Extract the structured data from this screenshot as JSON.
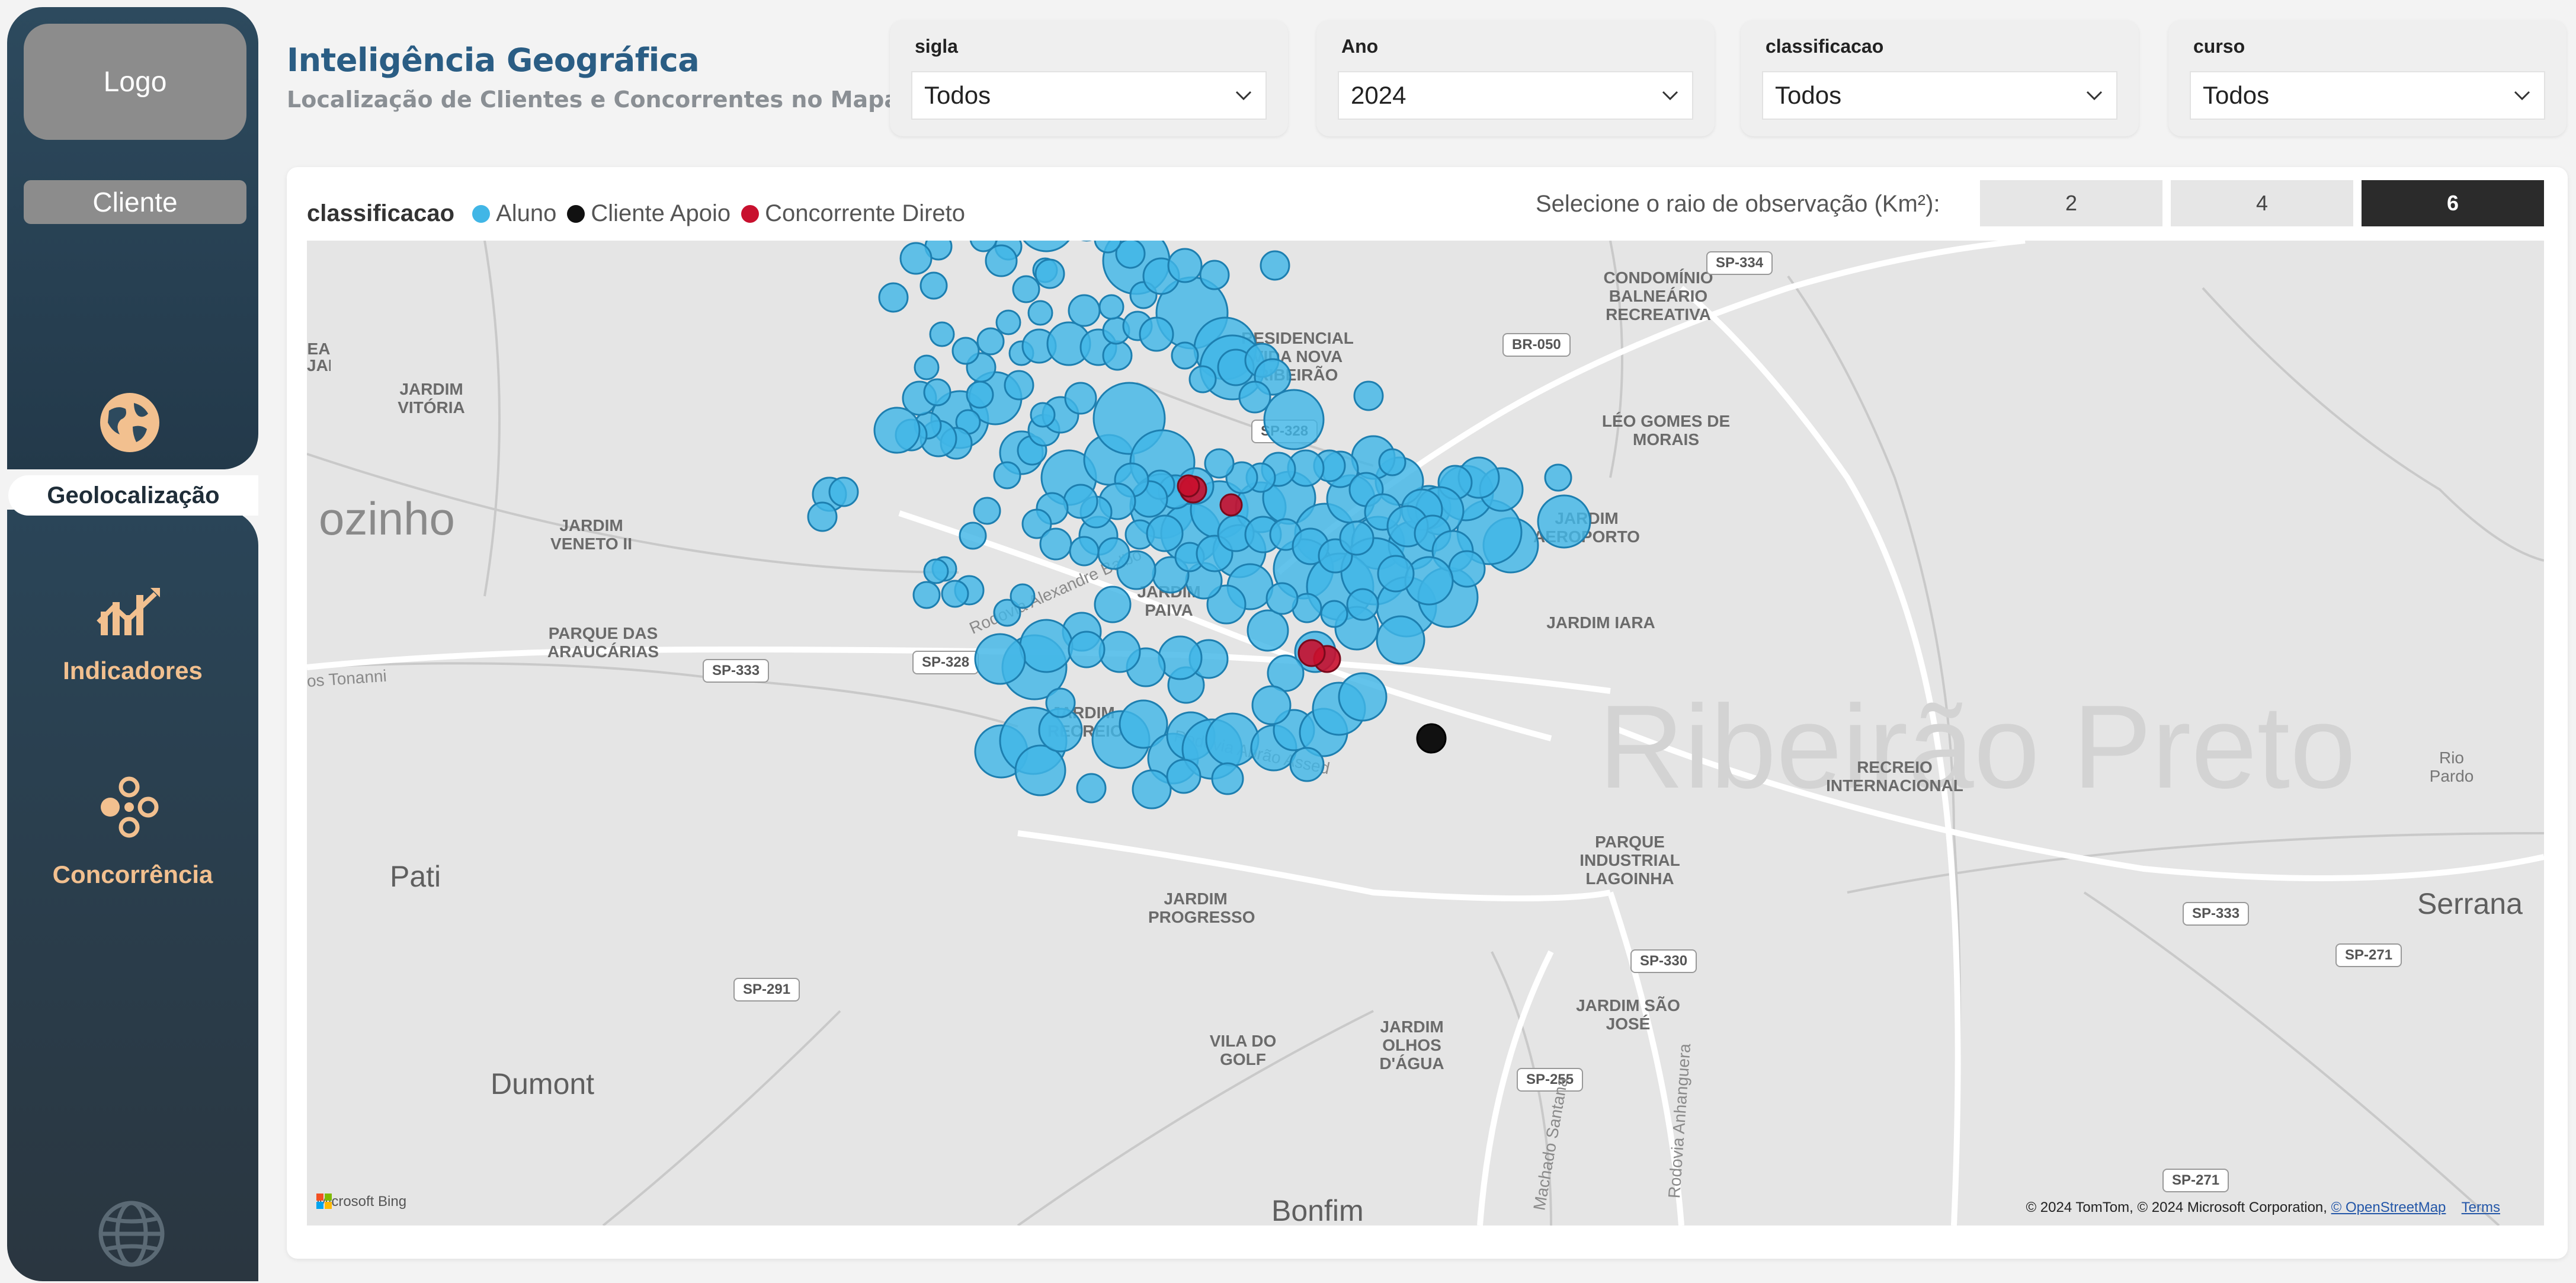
{
  "sidebar": {
    "logo": "Logo",
    "client": "Cliente",
    "nav": [
      {
        "label": "Geolocalização",
        "icon": "globe-icon",
        "active": true
      },
      {
        "label": "Indicadores",
        "icon": "chart-trend-icon",
        "active": false
      },
      {
        "label": "Concorrência",
        "icon": "network-icon",
        "active": false
      }
    ],
    "bottom_icon": "globe-outline-icon"
  },
  "header": {
    "title": "Inteligência Geográfica",
    "subtitle": "Localização de Clientes e Concorrentes no Mapa"
  },
  "filters": [
    {
      "label": "sigla",
      "value": "Todos"
    },
    {
      "label": "Ano",
      "value": "2024"
    },
    {
      "label": "classificacao",
      "value": "Todos"
    },
    {
      "label": "curso",
      "value": "Todos"
    }
  ],
  "legend": {
    "title": "classificacao",
    "items": [
      {
        "label": "Aluno",
        "color": "#41b6e6"
      },
      {
        "label": "Cliente Apoio",
        "color": "#111111"
      },
      {
        "label": "Concorrente Direto",
        "color": "#c8102e"
      }
    ]
  },
  "radius": {
    "label": "Selecione o raio de observação (Km²):",
    "options": [
      "2",
      "4",
      "6"
    ],
    "selected": "6"
  },
  "map": {
    "places": {
      "condominio": "CONDOMÍNIO BALNEÁRIO RECREATIVA",
      "residencial": "RESIDENCIAL VIDA NOVA RIBEIRÃO",
      "jardim_vitoria": "JARDIM VITÓRIA",
      "leo_gomes": "LÉO GOMES DE MORAIS",
      "jardim_aeroporto": "JARDIM AEROPORTO",
      "jardim_veneto": "JARDIM VENETO II",
      "parque_araucarias": "PARQUE DAS ARAUCÁRIAS",
      "jardim_paiva": "JARDIM PAIVA",
      "jardim_iara": "JARDIM IARA",
      "jardim_recreio": "JARDIM RECREIO",
      "recreio_internacional": "RECREIO INTERNACIONAL",
      "jardim_progresso": "JARDIM PROGRESSO",
      "parque_industrial": "PARQUE INDUSTRIAL LAGOINHA",
      "vila_golf": "VILA DO GOLF",
      "jardim_olhos": "JARDIM OLHOS D'ÁGUA",
      "jardim_sao_jose": "JARDIM SÃO JOSÉ",
      "ea": "EA",
      "jardim_edge": "JARDIM",
      "rio_pardo": "Rio Pardo"
    },
    "towns": {
      "ozinho": "ozinho",
      "pati": "Pati",
      "dumont": "Dumont",
      "bonfim": "Bonfim",
      "serrana": "Serrana",
      "ribeirao": "Ribeirão Preto"
    },
    "roads": [
      "SP-334",
      "BR-050",
      "SP-328",
      "SP-333",
      "SP-328",
      "SP-333",
      "SP-271",
      "SP-291",
      "SP-255",
      "SP-271",
      "SP-330"
    ],
    "road_names": {
      "alexandre": "Rodovia Alexandre Balbo",
      "abrao": "Rodovia Abrão Assed",
      "tonanni": "os Tonanni",
      "machado": "Machado Santana",
      "anhanguera": "Rodovia Anhanguera"
    },
    "bing": "Microsoft Bing",
    "attribution": "© 2024 TomTom, © 2024 Microsoft Corporation,",
    "osm": "© OpenStreetMap",
    "terms": "Terms"
  }
}
